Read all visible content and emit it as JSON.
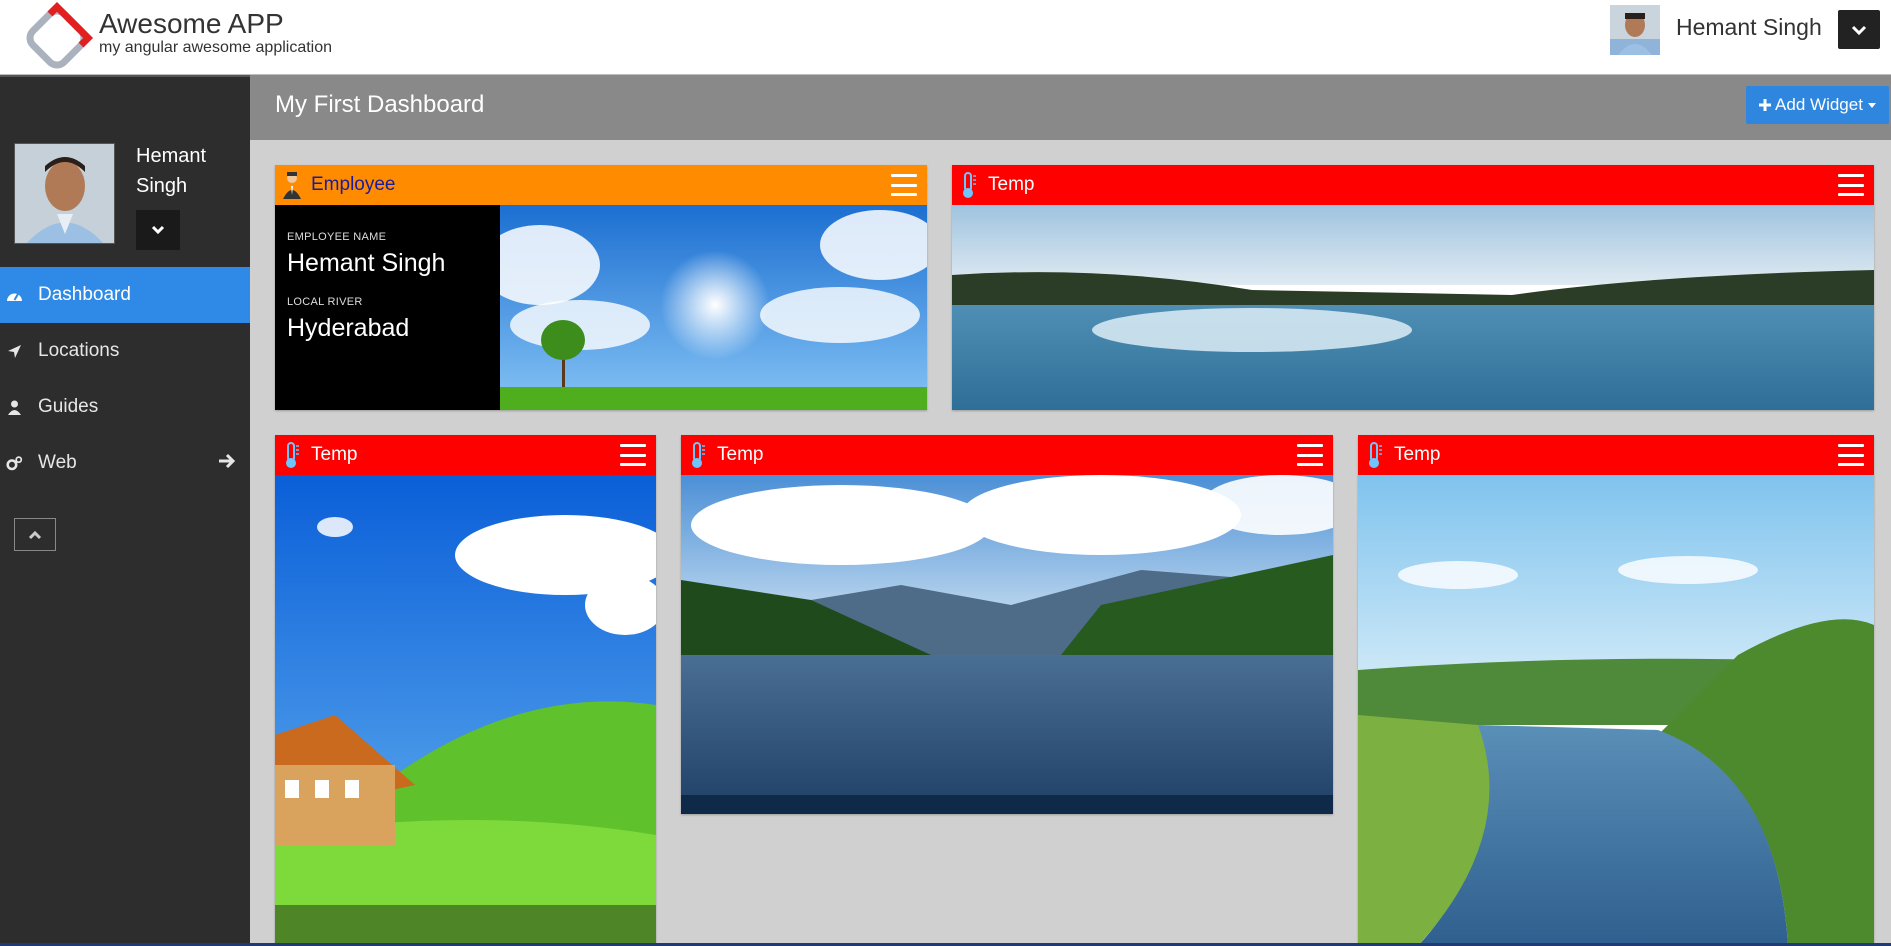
{
  "app": {
    "title": "Awesome APP",
    "subtitle": "my angular awesome application"
  },
  "user": {
    "name": "Hemant Singh",
    "first": "Hemant",
    "last": "Singh"
  },
  "sidebar": {
    "items": [
      {
        "label": "Dashboard",
        "icon": "dashboard-icon",
        "active": true
      },
      {
        "label": "Locations",
        "icon": "location-arrow-icon"
      },
      {
        "label": "Guides",
        "icon": "user-icon"
      },
      {
        "label": "Web",
        "icon": "cogs-icon"
      }
    ]
  },
  "main": {
    "title": "My First Dashboard",
    "add_widget_label": "Add Widget"
  },
  "widgets": [
    {
      "title": "Employee",
      "icon": "employee-icon",
      "header_color": "#ff8c00",
      "fields": [
        {
          "label": "EMPLOYEE NAME",
          "value": "Hemant Singh"
        },
        {
          "label": "LOCAL RIVER",
          "value": "Hyderabad"
        }
      ]
    },
    {
      "title": "Temp",
      "icon": "thermometer-icon",
      "header_color": "#ff0000"
    },
    {
      "title": "Temp",
      "icon": "thermometer-icon",
      "header_color": "#ff0000"
    },
    {
      "title": "Temp",
      "icon": "thermometer-icon",
      "header_color": "#ff0000"
    },
    {
      "title": "Temp",
      "icon": "thermometer-icon",
      "header_color": "#ff0000"
    }
  ],
  "colors": {
    "accent": "#2e8ae6",
    "sidebar": "#2d2d2d",
    "header_gray": "#898989"
  }
}
